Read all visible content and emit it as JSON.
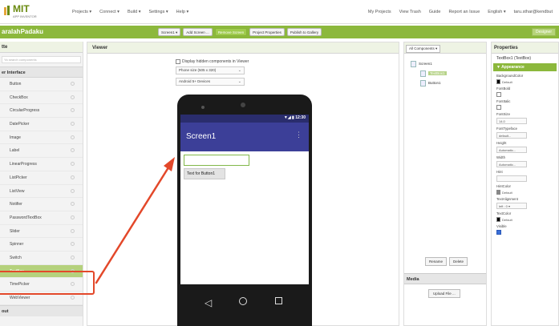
{
  "header": {
    "logo_title": "MIT",
    "logo_subtitle": "APP INVENTOR",
    "menu_left": [
      "Projects ▾",
      "Connect ▾",
      "Build ▾",
      "Settings ▾",
      "Help ▾"
    ],
    "menu_right": [
      "My Projects",
      "View Trash",
      "Guide",
      "Report an Issue",
      "English ▾",
      "taru.sthar@kendbut"
    ]
  },
  "project": {
    "name": "aralahPadaku",
    "buttons": [
      "Screen1 ▾",
      "Add Screen ...",
      "Remove Screen",
      "Project Properties",
      "Publish to Gallery"
    ],
    "designer_label": "Designer"
  },
  "palette": {
    "title": "tte",
    "search_placeholder": "Ya search components",
    "category": "er Interface",
    "items": [
      "Button",
      "CheckBox",
      "CircularProgress",
      "DatePicker",
      "Image",
      "Label",
      "LinearProgress",
      "ListPicker",
      "ListView",
      "Notifier",
      "PasswordTextBox",
      "Slider",
      "Spinner",
      "Switch",
      "TextBox",
      "TimePicker",
      "WebViewer"
    ],
    "selected_index": 14,
    "footer": "out"
  },
  "viewer": {
    "title": "Viewer",
    "checkbox_label": "Display hidden components in Viewer",
    "phone_size": "Phone size (505 x 320)",
    "android_theme": "Android 5+ Devices",
    "status_time": "▼◢ ▮ 12:30",
    "screen_title": "Screen1",
    "menu_dots": "⋮",
    "button_text": "Text for Button1",
    "nav_back": "◁"
  },
  "components": {
    "dropdown": "All Components ▾",
    "tree": [
      {
        "label": "Screen1",
        "indent": 0,
        "selected": false
      },
      {
        "label": "TextBox1",
        "indent": 1,
        "selected": true
      },
      {
        "label": "Button1",
        "indent": 1,
        "selected": false
      }
    ],
    "rename": "Rename",
    "delete": "Delete",
    "media_title": "Media",
    "upload": "Upload File ..."
  },
  "properties": {
    "title": "Properties",
    "component_name": "TextBox1 (TextBox)",
    "section": "▼ Appearance",
    "items": [
      {
        "label": "BackgroundColor",
        "kind": "color",
        "value": "Default",
        "color": "#000000"
      },
      {
        "label": "FontBold",
        "kind": "checkbox",
        "checked": false
      },
      {
        "label": "FontItalic",
        "kind": "checkbox",
        "checked": false
      },
      {
        "label": "FontSize",
        "kind": "input",
        "value": "14.0"
      },
      {
        "label": "FontTypeface",
        "kind": "input",
        "value": "default..."
      },
      {
        "label": "Height",
        "kind": "input",
        "value": "Automatic..."
      },
      {
        "label": "Width",
        "kind": "input",
        "value": "Automatic..."
      },
      {
        "label": "Hint",
        "kind": "input",
        "value": ""
      },
      {
        "label": "HintColor",
        "kind": "color",
        "value": "Default",
        "color": "#888888"
      },
      {
        "label": "TextAlignment",
        "kind": "input",
        "value": "left : 0 ▾"
      },
      {
        "label": "TextColor",
        "kind": "color",
        "value": "Default",
        "color": "#000000"
      },
      {
        "label": "Visible",
        "kind": "checkbox",
        "checked": true
      }
    ]
  },
  "colors": {
    "green": "#8cb83c",
    "title_bar": "#3c3f98",
    "annotation": "#e3482a"
  }
}
